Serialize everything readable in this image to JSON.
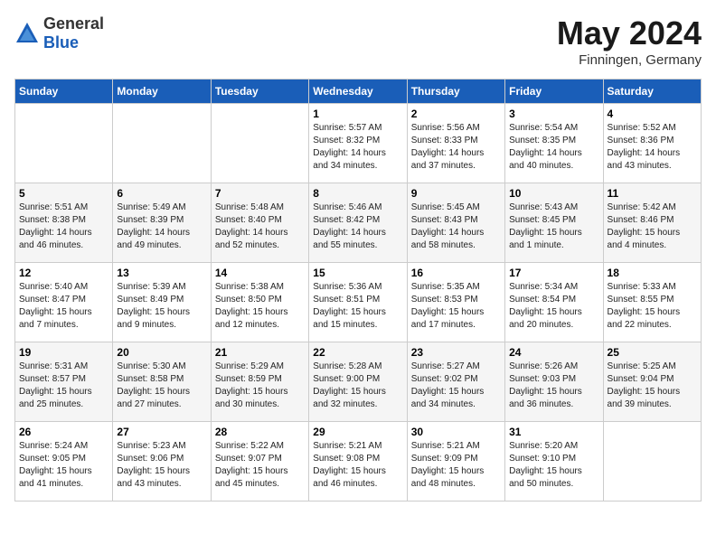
{
  "header": {
    "logo": {
      "general": "General",
      "blue": "Blue"
    },
    "title": "May 2024",
    "subtitle": "Finningen, Germany"
  },
  "calendar": {
    "weekdays": [
      "Sunday",
      "Monday",
      "Tuesday",
      "Wednesday",
      "Thursday",
      "Friday",
      "Saturday"
    ],
    "weeks": [
      [
        {
          "day": "",
          "info": ""
        },
        {
          "day": "",
          "info": ""
        },
        {
          "day": "",
          "info": ""
        },
        {
          "day": "1",
          "info": "Sunrise: 5:57 AM\nSunset: 8:32 PM\nDaylight: 14 hours\nand 34 minutes."
        },
        {
          "day": "2",
          "info": "Sunrise: 5:56 AM\nSunset: 8:33 PM\nDaylight: 14 hours\nand 37 minutes."
        },
        {
          "day": "3",
          "info": "Sunrise: 5:54 AM\nSunset: 8:35 PM\nDaylight: 14 hours\nand 40 minutes."
        },
        {
          "day": "4",
          "info": "Sunrise: 5:52 AM\nSunset: 8:36 PM\nDaylight: 14 hours\nand 43 minutes."
        }
      ],
      [
        {
          "day": "5",
          "info": "Sunrise: 5:51 AM\nSunset: 8:38 PM\nDaylight: 14 hours\nand 46 minutes."
        },
        {
          "day": "6",
          "info": "Sunrise: 5:49 AM\nSunset: 8:39 PM\nDaylight: 14 hours\nand 49 minutes."
        },
        {
          "day": "7",
          "info": "Sunrise: 5:48 AM\nSunset: 8:40 PM\nDaylight: 14 hours\nand 52 minutes."
        },
        {
          "day": "8",
          "info": "Sunrise: 5:46 AM\nSunset: 8:42 PM\nDaylight: 14 hours\nand 55 minutes."
        },
        {
          "day": "9",
          "info": "Sunrise: 5:45 AM\nSunset: 8:43 PM\nDaylight: 14 hours\nand 58 minutes."
        },
        {
          "day": "10",
          "info": "Sunrise: 5:43 AM\nSunset: 8:45 PM\nDaylight: 15 hours\nand 1 minute."
        },
        {
          "day": "11",
          "info": "Sunrise: 5:42 AM\nSunset: 8:46 PM\nDaylight: 15 hours\nand 4 minutes."
        }
      ],
      [
        {
          "day": "12",
          "info": "Sunrise: 5:40 AM\nSunset: 8:47 PM\nDaylight: 15 hours\nand 7 minutes."
        },
        {
          "day": "13",
          "info": "Sunrise: 5:39 AM\nSunset: 8:49 PM\nDaylight: 15 hours\nand 9 minutes."
        },
        {
          "day": "14",
          "info": "Sunrise: 5:38 AM\nSunset: 8:50 PM\nDaylight: 15 hours\nand 12 minutes."
        },
        {
          "day": "15",
          "info": "Sunrise: 5:36 AM\nSunset: 8:51 PM\nDaylight: 15 hours\nand 15 minutes."
        },
        {
          "day": "16",
          "info": "Sunrise: 5:35 AM\nSunset: 8:53 PM\nDaylight: 15 hours\nand 17 minutes."
        },
        {
          "day": "17",
          "info": "Sunrise: 5:34 AM\nSunset: 8:54 PM\nDaylight: 15 hours\nand 20 minutes."
        },
        {
          "day": "18",
          "info": "Sunrise: 5:33 AM\nSunset: 8:55 PM\nDaylight: 15 hours\nand 22 minutes."
        }
      ],
      [
        {
          "day": "19",
          "info": "Sunrise: 5:31 AM\nSunset: 8:57 PM\nDaylight: 15 hours\nand 25 minutes."
        },
        {
          "day": "20",
          "info": "Sunrise: 5:30 AM\nSunset: 8:58 PM\nDaylight: 15 hours\nand 27 minutes."
        },
        {
          "day": "21",
          "info": "Sunrise: 5:29 AM\nSunset: 8:59 PM\nDaylight: 15 hours\nand 30 minutes."
        },
        {
          "day": "22",
          "info": "Sunrise: 5:28 AM\nSunset: 9:00 PM\nDaylight: 15 hours\nand 32 minutes."
        },
        {
          "day": "23",
          "info": "Sunrise: 5:27 AM\nSunset: 9:02 PM\nDaylight: 15 hours\nand 34 minutes."
        },
        {
          "day": "24",
          "info": "Sunrise: 5:26 AM\nSunset: 9:03 PM\nDaylight: 15 hours\nand 36 minutes."
        },
        {
          "day": "25",
          "info": "Sunrise: 5:25 AM\nSunset: 9:04 PM\nDaylight: 15 hours\nand 39 minutes."
        }
      ],
      [
        {
          "day": "26",
          "info": "Sunrise: 5:24 AM\nSunset: 9:05 PM\nDaylight: 15 hours\nand 41 minutes."
        },
        {
          "day": "27",
          "info": "Sunrise: 5:23 AM\nSunset: 9:06 PM\nDaylight: 15 hours\nand 43 minutes."
        },
        {
          "day": "28",
          "info": "Sunrise: 5:22 AM\nSunset: 9:07 PM\nDaylight: 15 hours\nand 45 minutes."
        },
        {
          "day": "29",
          "info": "Sunrise: 5:21 AM\nSunset: 9:08 PM\nDaylight: 15 hours\nand 46 minutes."
        },
        {
          "day": "30",
          "info": "Sunrise: 5:21 AM\nSunset: 9:09 PM\nDaylight: 15 hours\nand 48 minutes."
        },
        {
          "day": "31",
          "info": "Sunrise: 5:20 AM\nSunset: 9:10 PM\nDaylight: 15 hours\nand 50 minutes."
        },
        {
          "day": "",
          "info": ""
        }
      ]
    ]
  }
}
